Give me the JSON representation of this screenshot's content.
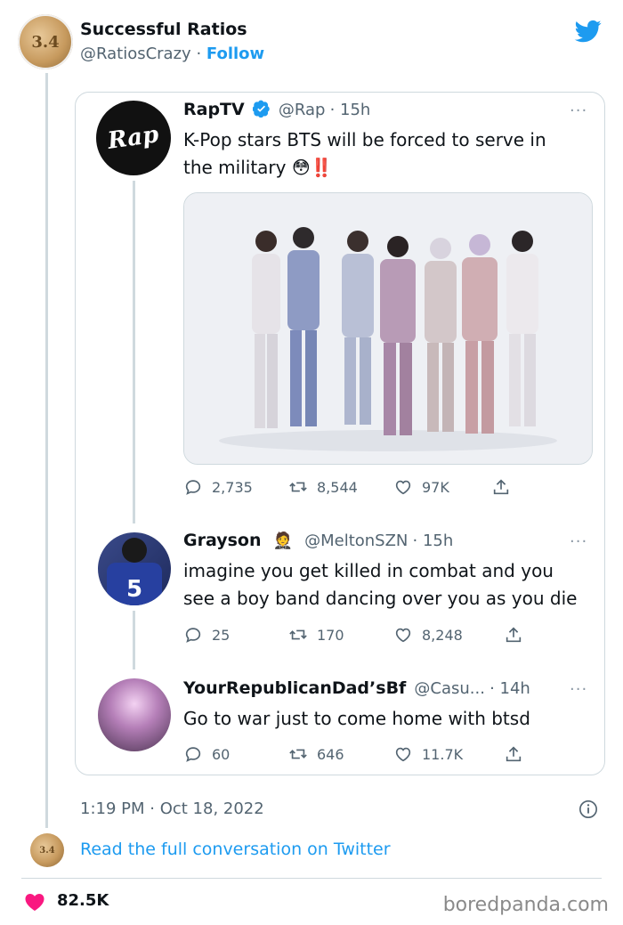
{
  "header": {
    "account_name": "Successful Ratios",
    "account_handle": "@RatiosCrazy",
    "separator": "·",
    "follow_label": "Follow",
    "avatar_text": "3.4"
  },
  "quoted_tweet": {
    "avatar_text": "Rap",
    "name": "RapTV",
    "handle": "@Rap",
    "time": "· 15h",
    "text_line1": "K-Pop stars BTS will be forced to serve in",
    "text_line2": "the military 😳‼️",
    "replies": "2,735",
    "retweets": "8,544",
    "likes": "97K"
  },
  "replies": [
    {
      "name": "Grayson",
      "emoji": "🤵",
      "handle": "@MeltonSZN",
      "time": "· 15h",
      "text_line1": "imagine you get killed in combat and you",
      "text_line2": "see a boy band dancing over you as you die",
      "replies": "25",
      "retweets": "170",
      "likes": "8,248",
      "jersey_number": "5"
    },
    {
      "name": "YourRepublicanDad’sBf",
      "handle": "@Casu...",
      "time": "· 14h",
      "text": "Go to war just to come home with btsd",
      "replies": "60",
      "retweets": "646",
      "likes": "11.7K"
    }
  ],
  "footer": {
    "timestamp": "1:19 PM · Oct 18, 2022",
    "read_link": "Read the full conversation on Twitter",
    "likes_total": "82.5K",
    "watermark": "boredpanda.com"
  },
  "colors": {
    "accent": "#1d9bf0",
    "heart": "#f91880",
    "muted": "#536471"
  }
}
